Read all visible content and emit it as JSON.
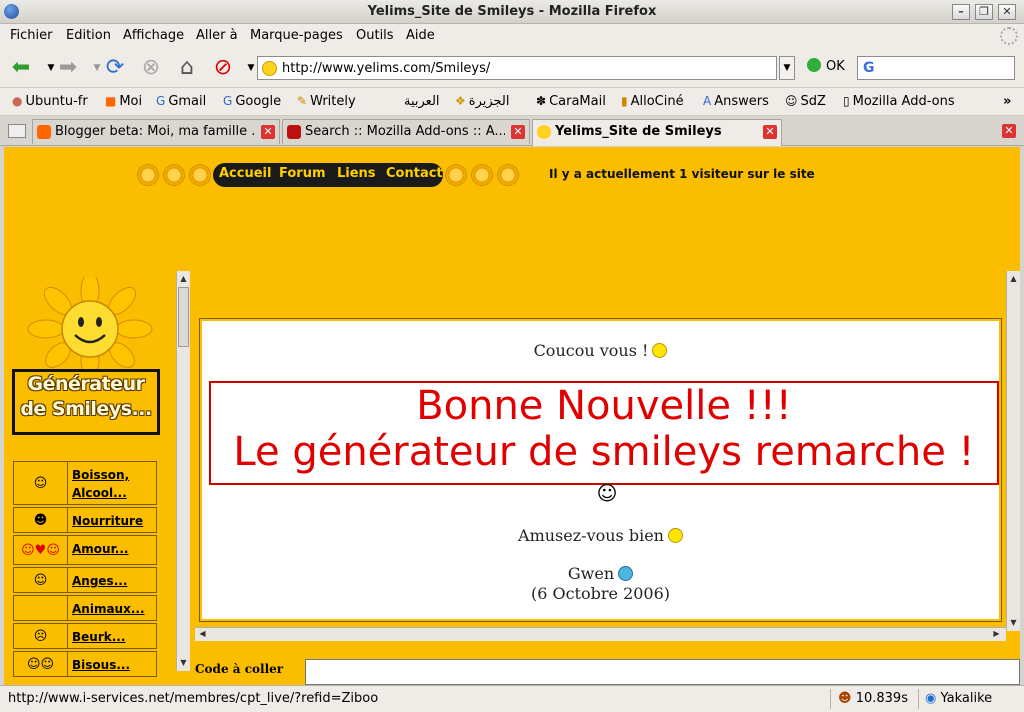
{
  "window": {
    "title": "Yelims_Site de Smileys - Mozilla Firefox"
  },
  "menu": [
    "Fichier",
    "Edition",
    "Affichage",
    "Aller à",
    "Marque-pages",
    "Outils",
    "Aide"
  ],
  "nav": {
    "url": "http://www.yelims.com/Smileys/",
    "go_label": "OK"
  },
  "bookmarks": [
    "Ubuntu-fr",
    "Moi",
    "Gmail",
    "Google",
    "Writely",
    "العربية",
    "الجزيرة",
    "CaraMail",
    "AlloCiné",
    "Answers",
    "SdZ",
    "Mozilla Add-ons"
  ],
  "tabs": [
    {
      "label": "Blogger beta: Moi, ma famille ...",
      "active": false
    },
    {
      "label": "Search :: Mozilla Add-ons :: A...",
      "active": false
    },
    {
      "label": "Yelims_Site de Smileys",
      "active": true
    }
  ],
  "site": {
    "nav": [
      "Accueil",
      "Forum",
      "Liens",
      "Contact"
    ],
    "visitors": "Il y a actuellement 1 visiteur sur le site",
    "logo_line1": "Générateur",
    "logo_line2": "de Smileys...",
    "categories": [
      {
        "label": "Boisson, Alcool..."
      },
      {
        "label": "Nourriture"
      },
      {
        "label": "Amour..."
      },
      {
        "label": "Anges..."
      },
      {
        "label": "Animaux..."
      },
      {
        "label": "Beurk..."
      },
      {
        "label": "Bisous..."
      }
    ],
    "greeting": "Coucou vous !",
    "banner_line1": "Bonne Nouvelle !!!",
    "banner_line2": "Le générateur de smileys remarche !",
    "enjoy": "Amusez-vous bien",
    "signature": "Gwen",
    "date": "(6 Octobre 2006)",
    "code_label": "Code à coller"
  },
  "status": {
    "text": "http://www.i-services.net/membres/cpt_live/?refid=Ziboo",
    "time": "10.839s",
    "engine": "Yakalike"
  }
}
